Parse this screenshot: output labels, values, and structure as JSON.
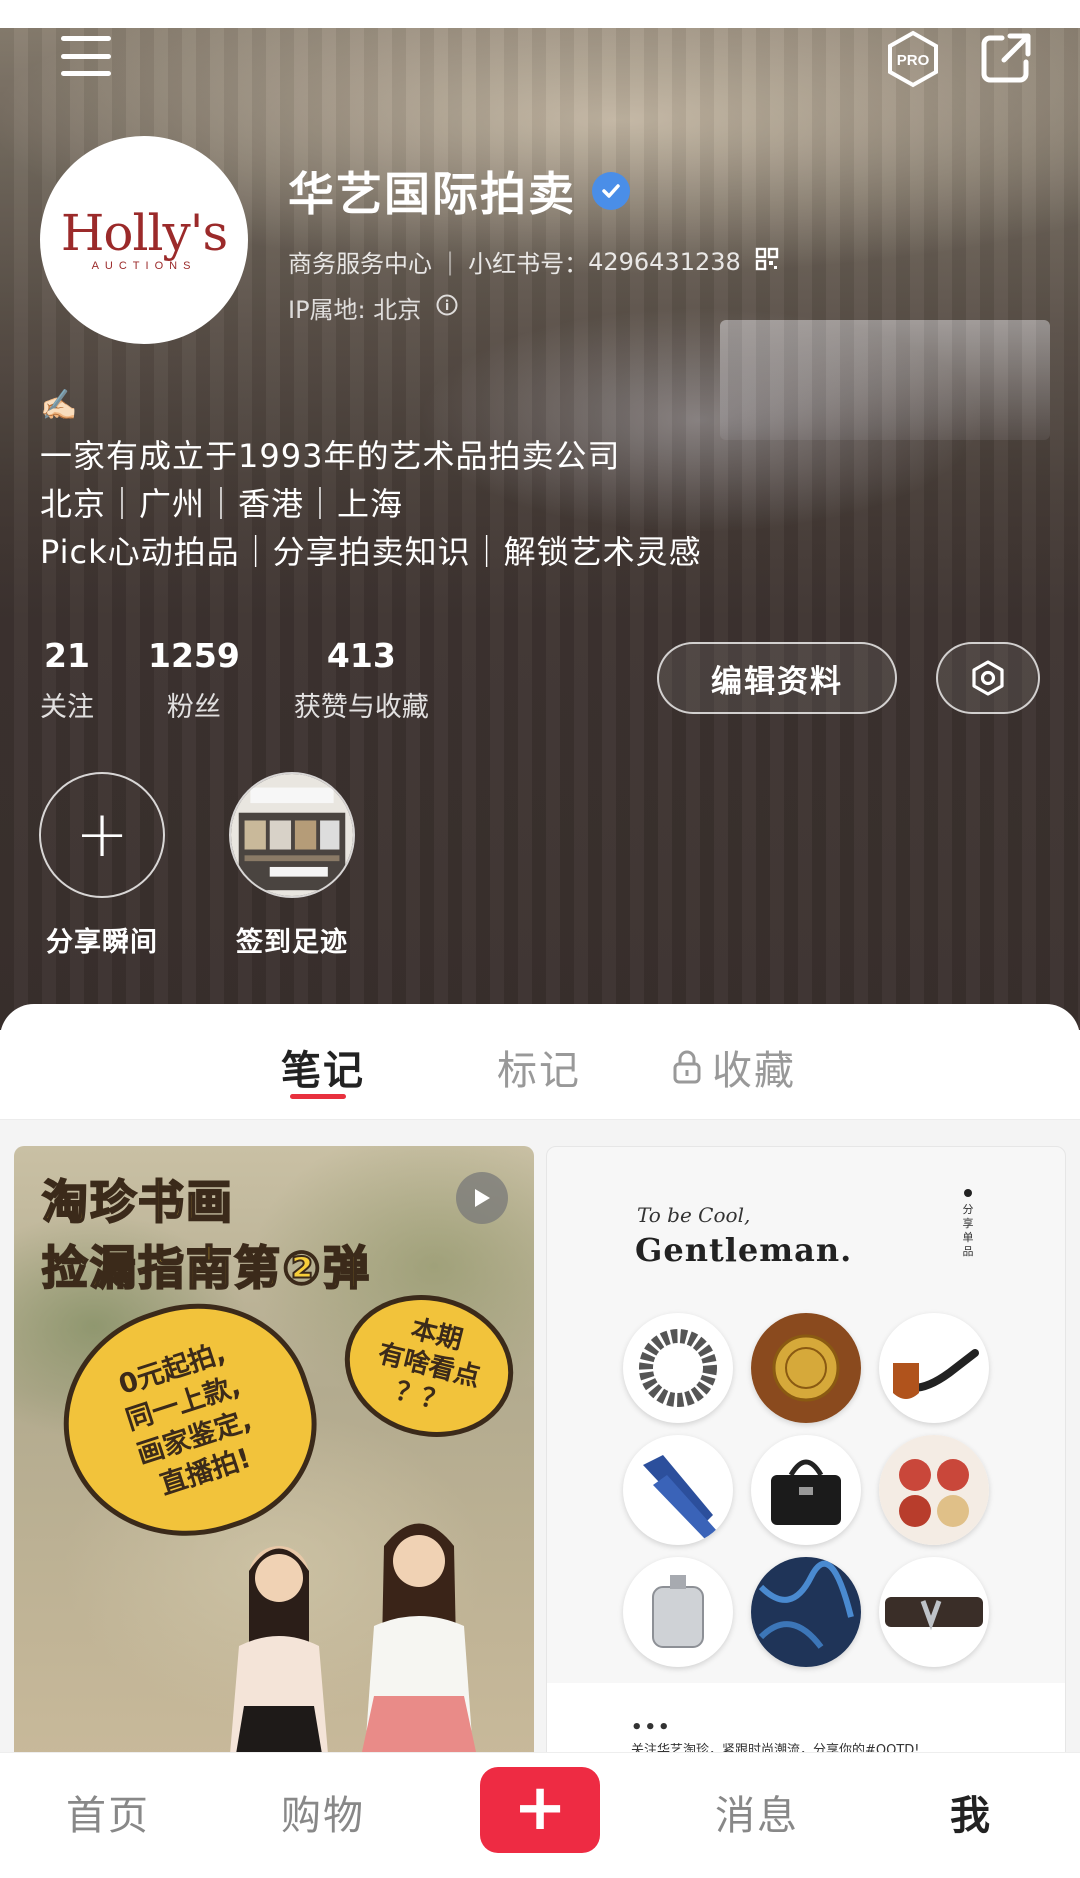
{
  "profile": {
    "avatar_logo_text": "Holly's",
    "avatar_logo_sub": "AUCTIONS",
    "name": "华艺国际拍卖",
    "category": "商务服务中心",
    "id_label": "小红书号：",
    "id_value": "4296431238",
    "ip_location": "IP属地: 北京",
    "bio_icon": "✍🏻",
    "bio_lines": [
      "一家有成立于1993年的艺术品拍卖公司",
      "北京｜广州｜香港｜上海",
      "Pick心动拍品｜分享拍卖知识｜解锁艺术灵感"
    ]
  },
  "stats": [
    {
      "value": "21",
      "label": "关注"
    },
    {
      "value": "1259",
      "label": "粉丝"
    },
    {
      "value": "413",
      "label": "获赞与收藏"
    }
  ],
  "buttons": {
    "edit_profile": "编辑资料"
  },
  "moments": [
    {
      "label": "分享瞬间"
    },
    {
      "label": "签到足迹"
    }
  ],
  "tabs": [
    {
      "label": "笔记",
      "active": true
    },
    {
      "label": "标记",
      "active": false
    },
    {
      "label": "收藏",
      "active": false,
      "locked": true
    }
  ],
  "notes": [
    {
      "title_line1": "淘珍书画",
      "title_line2": "捡漏指南第②弹",
      "bubble_left": [
        "0元起拍,",
        "同一上款,",
        "画家鉴定,",
        "直播拍!"
      ],
      "bubble_right": [
        "本期",
        "有啥看点",
        "？？"
      ],
      "is_video": true
    },
    {
      "script_line": "To be Cool,",
      "headline": "Gentleman.",
      "vertical_label": [
        "分",
        "享",
        "单",
        "品"
      ],
      "dots": "•••",
      "footer": "关注华艺淘珍，紧跟时尚潮流，分享你的#OOTD!"
    }
  ],
  "bottom_nav": [
    {
      "label": "首页",
      "active": false
    },
    {
      "label": "购物",
      "active": false
    },
    {
      "label": "消息",
      "active": false
    },
    {
      "label": "我",
      "active": true
    }
  ],
  "colors": {
    "accent_red": "#ee2b43",
    "tab_underline": "#e8303e",
    "verified_blue": "#4a8ee8",
    "logo_red": "#9b2a2a"
  },
  "icons": [
    "menu-icon",
    "pro-badge-icon",
    "share-icon",
    "verified-icon",
    "qr-code-icon",
    "info-icon",
    "settings-icon",
    "plus-icon",
    "lock-icon",
    "play-icon"
  ]
}
